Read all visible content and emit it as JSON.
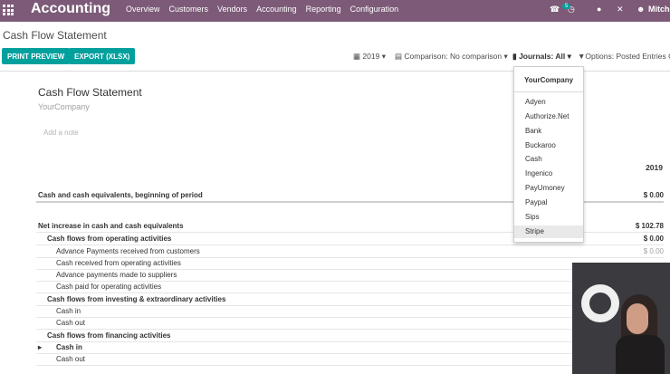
{
  "navbar": {
    "app_name": "Accounting",
    "menu": [
      "Overview",
      "Customers",
      "Vendors",
      "Accounting",
      "Reporting",
      "Configuration"
    ],
    "activity_count": "5",
    "user": "Mitche",
    "icons": [
      "apps-icon",
      "phone-icon",
      "activity-clock-icon",
      "chat-icon",
      "close-icon",
      "user-avatar"
    ]
  },
  "breadcrumb": "Cash Flow Statement",
  "toolbar": {
    "print_preview": "PRINT PREVIEW",
    "export_xlsx": "EXPORT (XLSX)",
    "filter_date": "2019",
    "filter_comparison": "Comparison: No comparison",
    "filter_journals": "Journals: All",
    "filter_options": "Options: Posted Entries O"
  },
  "report": {
    "title": "Cash Flow Statement",
    "company": "YourCompany",
    "note_placeholder": "Add a note",
    "column_header": "2019",
    "lines": [
      {
        "label": "Cash and cash equivalents, beginning of period",
        "value": "$ 0.00"
      },
      {
        "label": "Net increase in cash and cash equivalents",
        "value": "$ 102.78"
      },
      {
        "label": "Cash flows from operating activities",
        "value": "$ 0.00"
      },
      {
        "label": "Advance Payments received from customers",
        "value": "$ 0.00"
      },
      {
        "label": "Cash received from operating activities",
        "value": ""
      },
      {
        "label": "Advance payments made to suppliers",
        "value": ""
      },
      {
        "label": "Cash paid for operating activities",
        "value": ""
      },
      {
        "label": "Cash flows from investing & extraordinary activities",
        "value": ""
      },
      {
        "label": "Cash in",
        "value": ""
      },
      {
        "label": "Cash out",
        "value": ""
      },
      {
        "label": "Cash flows from financing activities",
        "value": ""
      },
      {
        "label": "Cash in",
        "value": ""
      },
      {
        "label": "Cash out",
        "value": ""
      }
    ]
  },
  "journals_dropdown": {
    "company": "YourCompany",
    "items": [
      "Adyen",
      "Authorize.Net",
      "Bank",
      "Buckaroo",
      "Cash",
      "Ingenico",
      "PayUmoney",
      "Paypal",
      "Sips",
      "Stripe"
    ]
  },
  "colors": {
    "navbar": "#7c5a78",
    "accent": "#00a09d"
  }
}
